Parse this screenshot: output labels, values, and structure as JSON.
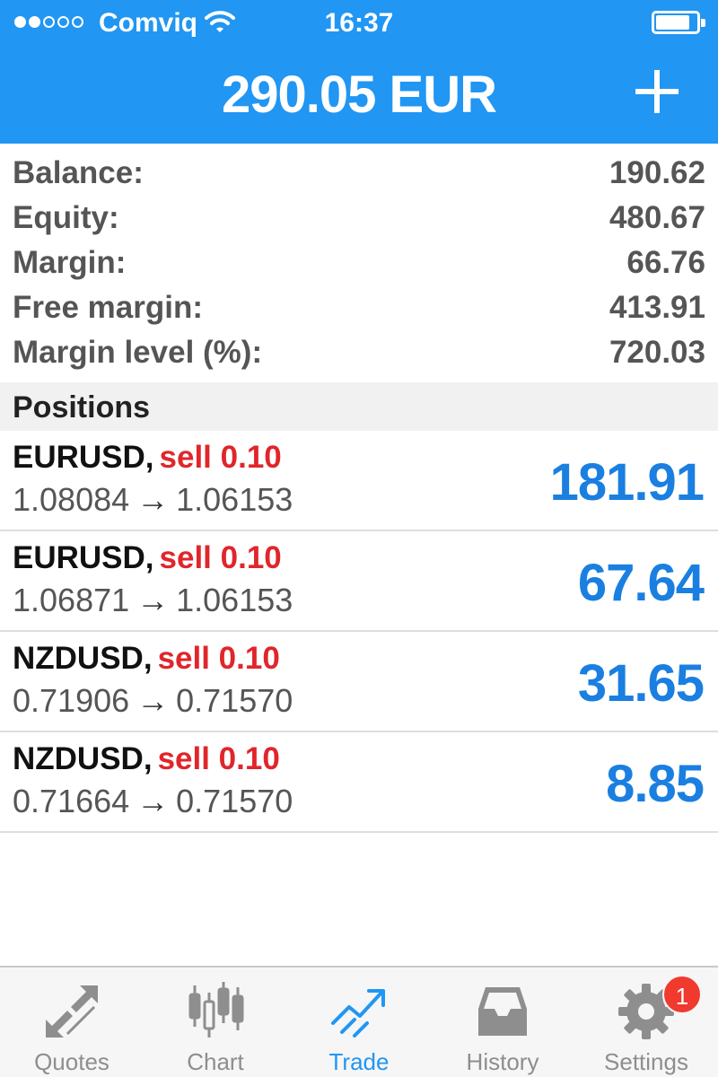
{
  "status_bar": {
    "carrier": "Comviq",
    "time": "16:37",
    "signal_bars": 2,
    "battery_level": 0.85,
    "icons": [
      "signal-dots-icon",
      "wifi-icon",
      "battery-icon"
    ]
  },
  "header": {
    "title": "290.05 EUR",
    "add_icon": "plus-icon"
  },
  "account": {
    "rows": [
      {
        "label": "Balance:",
        "value": "190.62"
      },
      {
        "label": "Equity:",
        "value": "480.67"
      },
      {
        "label": "Margin:",
        "value": "66.76"
      },
      {
        "label": "Free margin:",
        "value": "413.91"
      },
      {
        "label": "Margin level (%):",
        "value": "720.03"
      }
    ]
  },
  "positions": {
    "header": "Positions",
    "arrow": "→",
    "items": [
      {
        "symbol": "EURUSD,",
        "side": "sell 0.10",
        "open_price": "1.08084",
        "current_price": "1.06153",
        "profit": "181.91"
      },
      {
        "symbol": "EURUSD,",
        "side": "sell 0.10",
        "open_price": "1.06871",
        "current_price": "1.06153",
        "profit": "67.64"
      },
      {
        "symbol": "NZDUSD,",
        "side": "sell 0.10",
        "open_price": "0.71906",
        "current_price": "0.71570",
        "profit": "31.65"
      },
      {
        "symbol": "NZDUSD,",
        "side": "sell 0.10",
        "open_price": "0.71664",
        "current_price": "0.71570",
        "profit": "8.85"
      }
    ]
  },
  "tabbar": {
    "tabs": [
      {
        "label": "Quotes",
        "icon": "quotes-arrows-icon",
        "active": false
      },
      {
        "label": "Chart",
        "icon": "candlestick-chart-icon",
        "active": false
      },
      {
        "label": "Trade",
        "icon": "trade-trend-icon",
        "active": true
      },
      {
        "label": "History",
        "icon": "inbox-tray-icon",
        "active": false
      },
      {
        "label": "Settings",
        "icon": "gear-icon",
        "active": false
      }
    ],
    "settings_badge": "1"
  },
  "colors": {
    "header_blue": "#2196f3",
    "profit_blue": "#1a7fe0",
    "sell_red": "#e0262b",
    "badge_red": "#f03a2e",
    "tab_inactive": "#8e8e8e"
  }
}
